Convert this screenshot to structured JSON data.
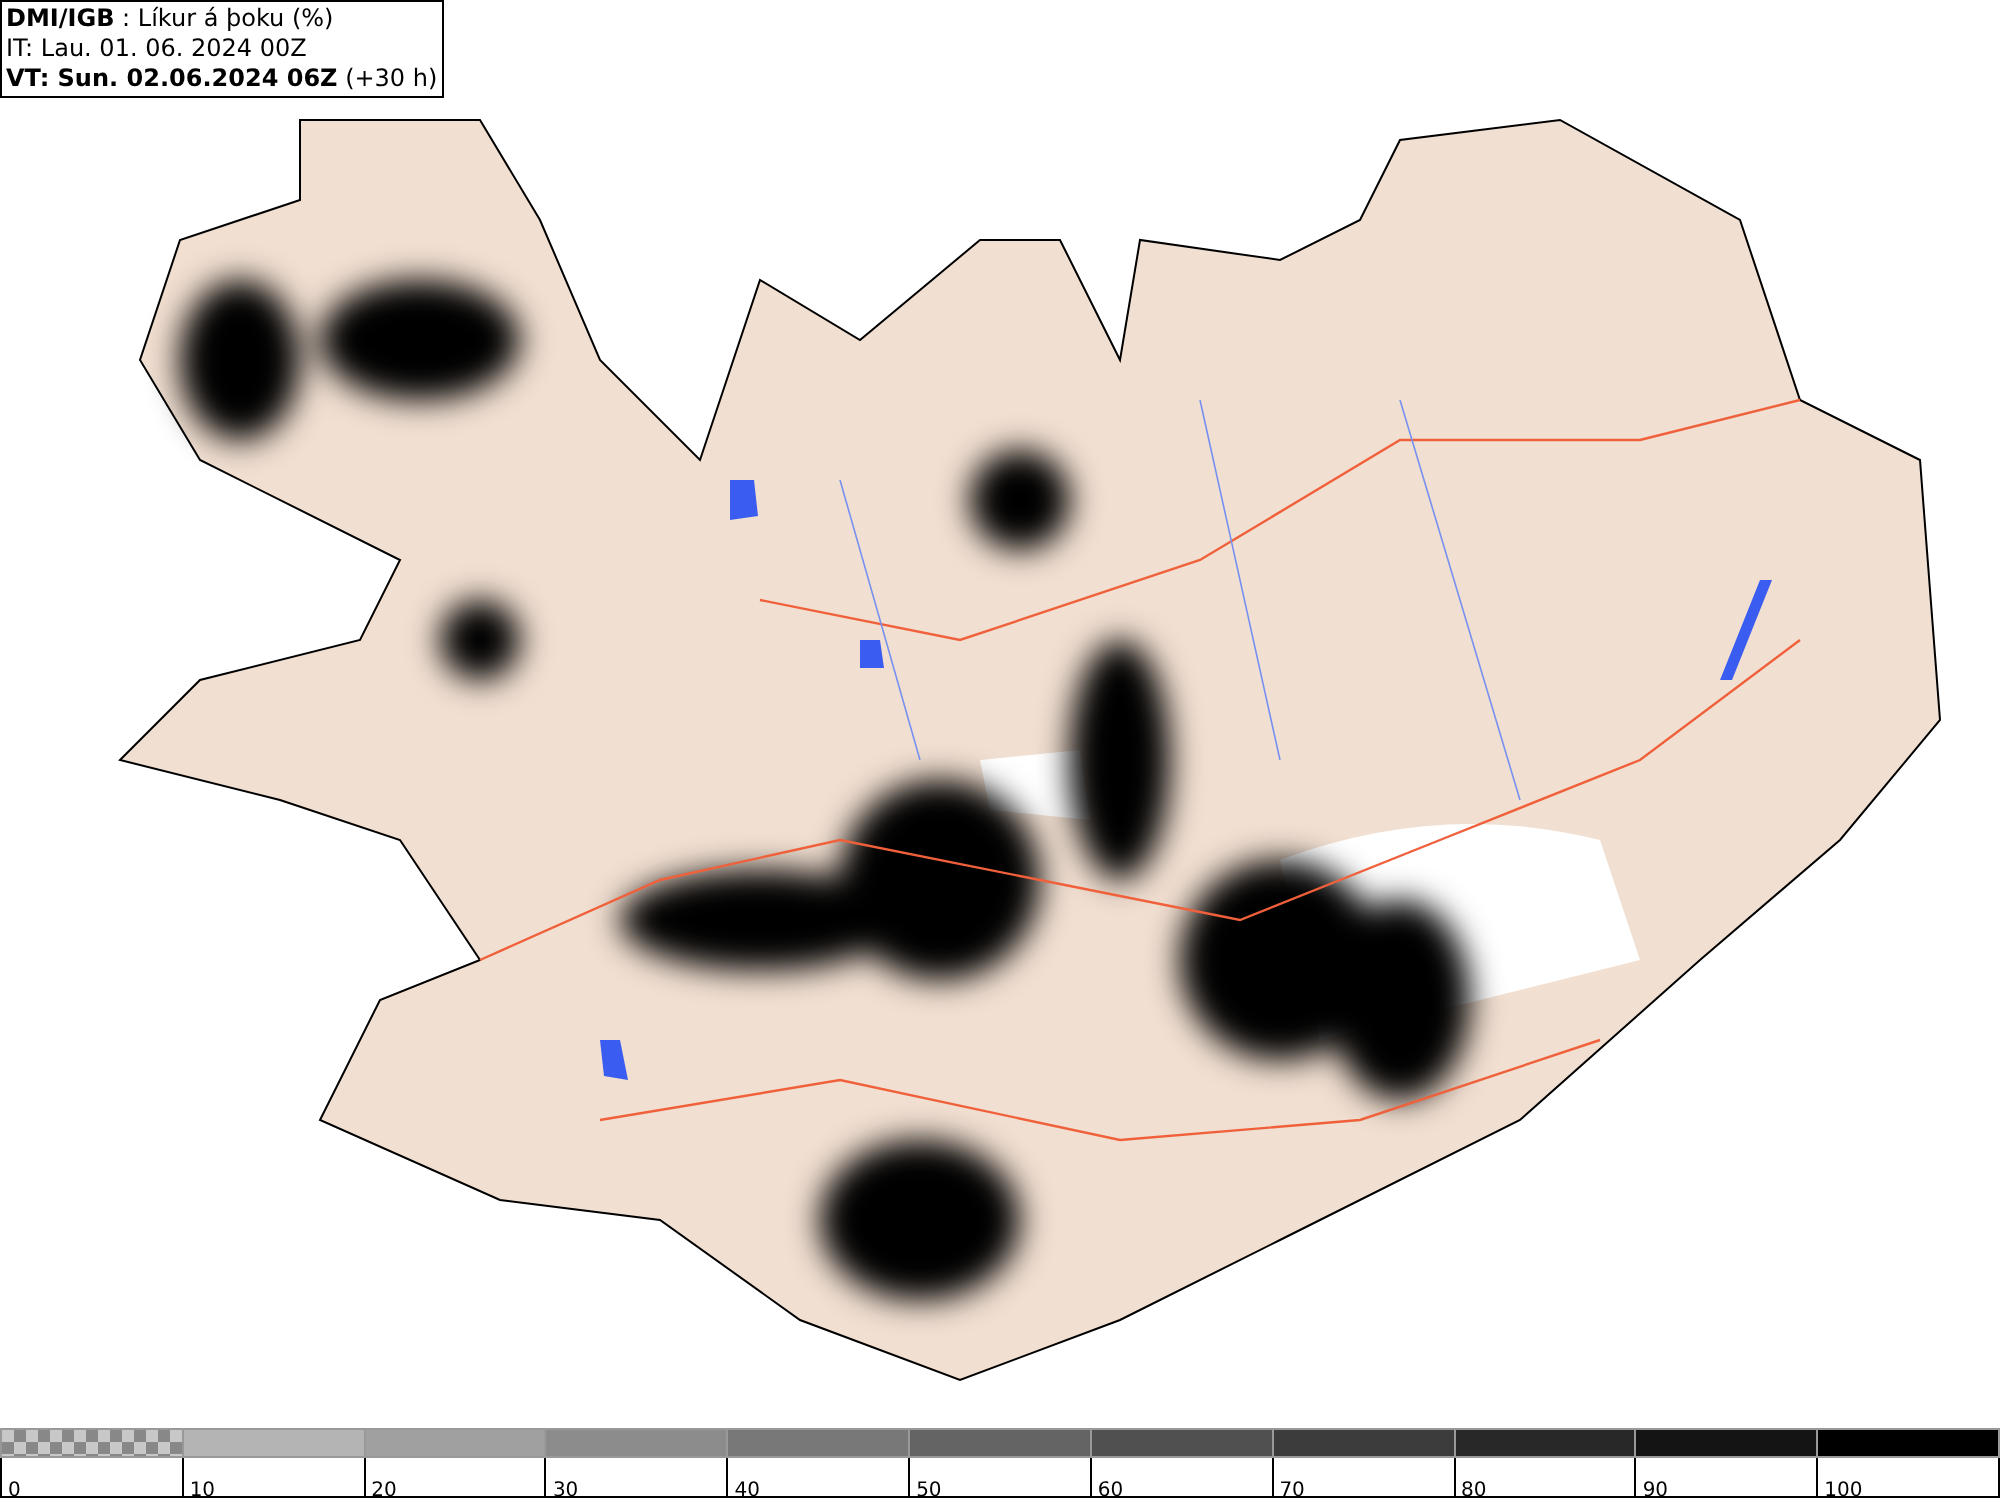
{
  "header": {
    "lines": [
      "**DMI/IGB** : Líkur á þoku (%)",
      "IT: Lau. 01. 06. 2024 00Z",
      "**VT: Sun. 02.06.2024 06Z** (+30 h)"
    ]
  },
  "legend": {
    "swatches": [
      {
        "kind": "checker",
        "color": "#888888"
      },
      {
        "kind": "solid",
        "color": "#b4b4b4"
      },
      {
        "kind": "solid",
        "color": "#a0a0a0"
      },
      {
        "kind": "solid",
        "color": "#8c8c8c"
      },
      {
        "kind": "solid",
        "color": "#787878"
      },
      {
        "kind": "solid",
        "color": "#646464"
      },
      {
        "kind": "solid",
        "color": "#505050"
      },
      {
        "kind": "solid",
        "color": "#3c3c3c"
      },
      {
        "kind": "solid",
        "color": "#282828"
      },
      {
        "kind": "solid",
        "color": "#141414"
      },
      {
        "kind": "solid",
        "color": "#000000"
      }
    ],
    "labels": [
      "0",
      "10",
      "20",
      "30",
      "40",
      "50",
      "60",
      "70",
      "80",
      "90",
      "100"
    ]
  }
}
